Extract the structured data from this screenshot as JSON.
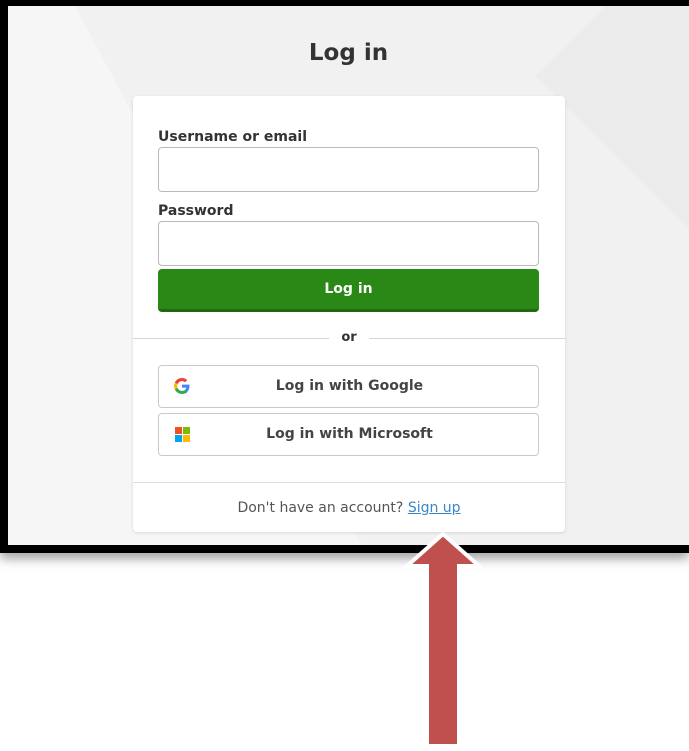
{
  "page": {
    "title": "Log in"
  },
  "form": {
    "username_label": "Username or email",
    "username_value": "",
    "password_label": "Password",
    "password_value": "",
    "login_button": "Log in",
    "divider": "or"
  },
  "sso": {
    "google_label": "Log in with Google",
    "google_icon": "google-g-icon",
    "microsoft_label": "Log in with Microsoft",
    "microsoft_icon": "microsoft-logo-icon"
  },
  "footer": {
    "prompt": "Don't have an account?",
    "signup_link": "Sign up"
  },
  "colors": {
    "login_green": "#2a8816",
    "link_blue": "#3a86c8",
    "arrow_red": "#c0504d"
  }
}
